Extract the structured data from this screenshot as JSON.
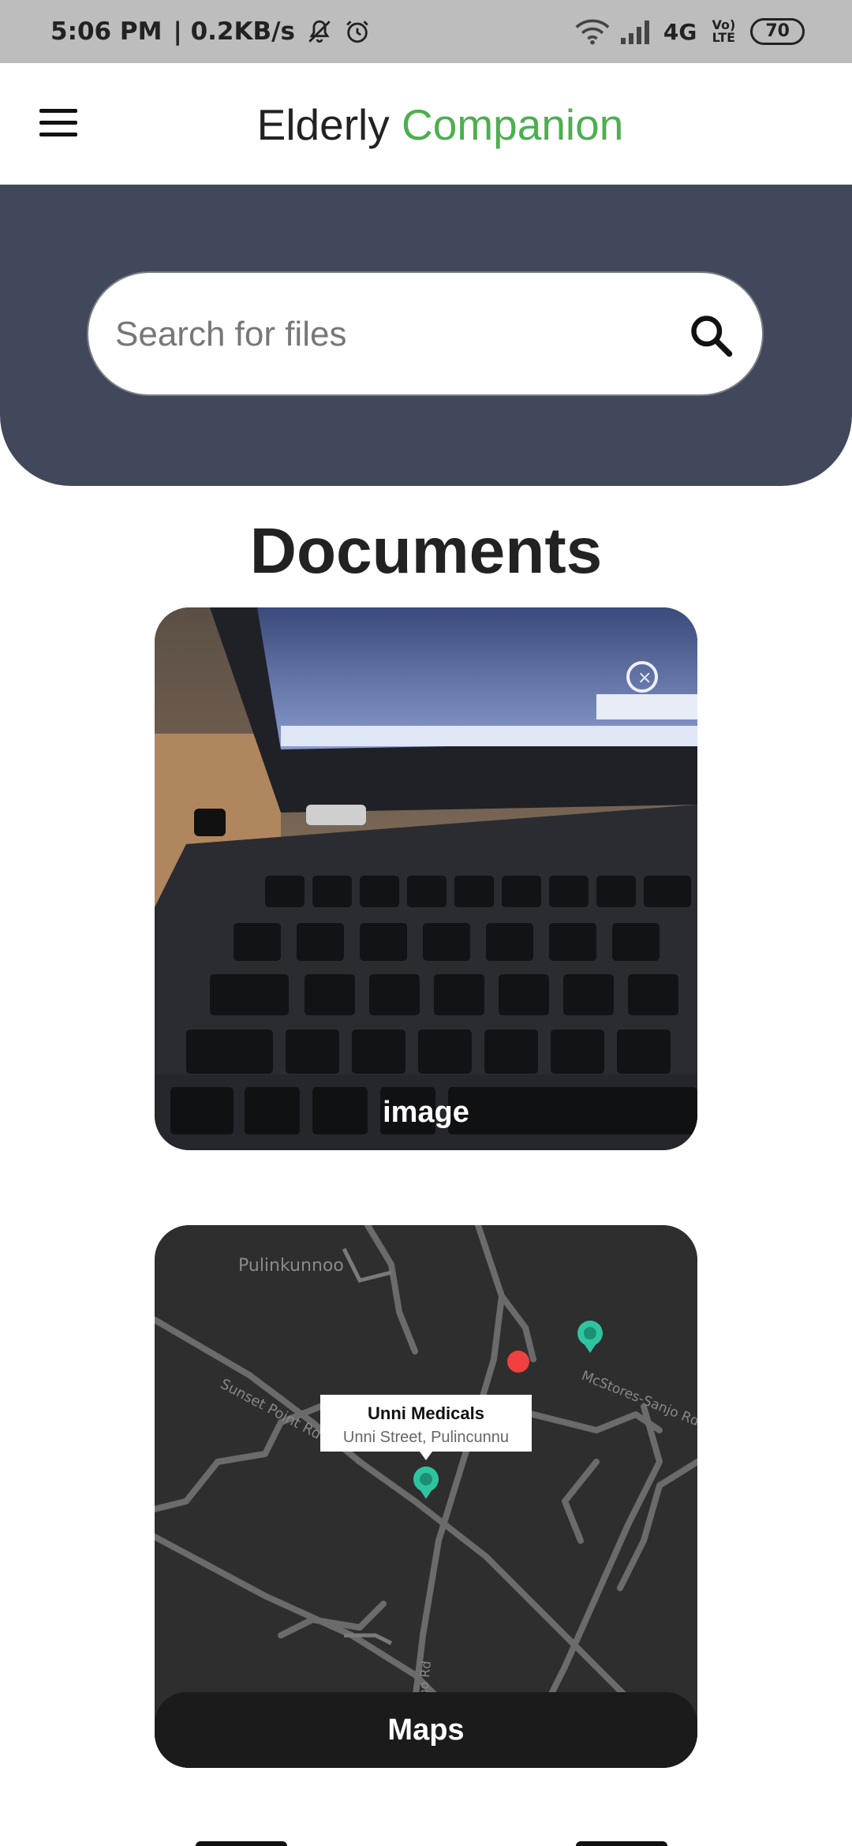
{
  "status_bar": {
    "time": "5:06 PM",
    "net_speed": "| 0.2KB/s",
    "network": "4G",
    "volte": "Vo) LTE",
    "battery": "70",
    "icons": [
      "mute-bell-icon",
      "alarm-icon",
      "wifi-icon",
      "signal-icon"
    ]
  },
  "app_bar": {
    "title_part1": "Elderly ",
    "title_part2": "Companion",
    "accent_color": "#4caf50",
    "menu_icon": "hamburger-menu-icon"
  },
  "hero": {
    "background_color": "#42485b",
    "search": {
      "placeholder": "Search for files",
      "value": "",
      "icon": "search-icon"
    }
  },
  "documents": {
    "title": "Documents",
    "cards": [
      {
        "label": "image",
        "icon": "laptop-photo-thumbnail"
      },
      {
        "label": "Maps",
        "map_place_label": "Pulinkunnoo",
        "road_label_1": "Sunset Point Rd",
        "road_label_2": "McStores-Sanjo Rd",
        "road_label_3": "Kainkariomoo Rd",
        "marker_title": "Unni Medicals",
        "marker_address": "Unni Street, Pulincunnu"
      }
    ]
  }
}
